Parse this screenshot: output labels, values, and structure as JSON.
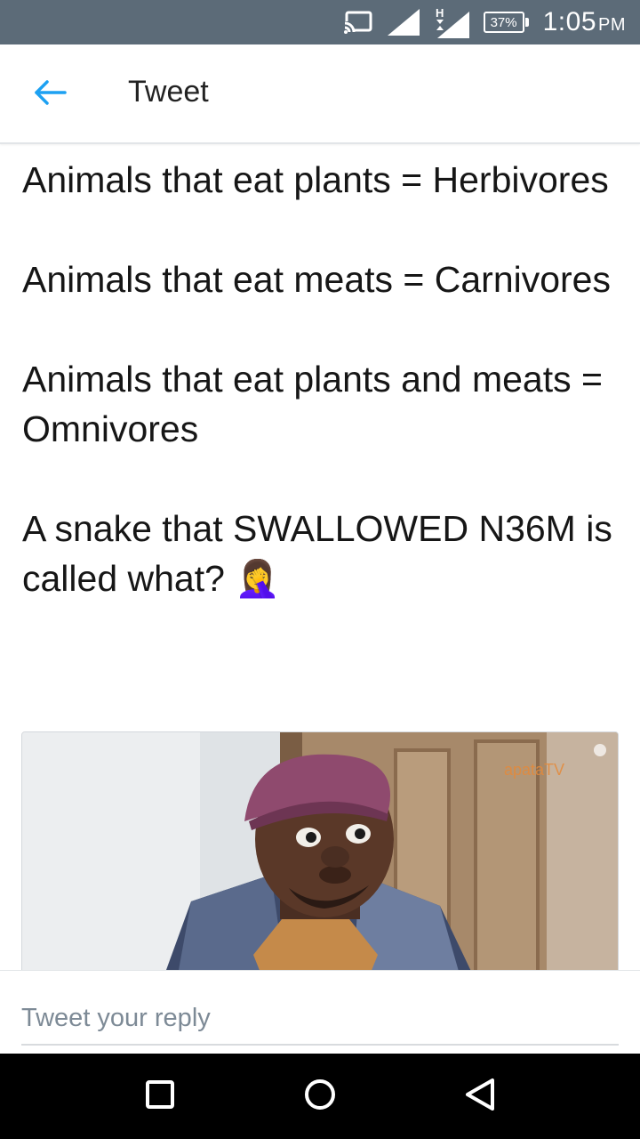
{
  "status_bar": {
    "battery": "37%",
    "time": "1:05",
    "ampm": "PM",
    "icons": [
      "cast-icon",
      "cell-signal-icon",
      "h-data-signal-icon",
      "battery-icon"
    ]
  },
  "app_bar": {
    "title": "Tweet",
    "back_icon": "back-arrow-icon",
    "accent_color": "#1da1f2"
  },
  "tweet": {
    "paragraphs": [
      "Animals that eat plants = Herbivores",
      "Animals that eat meats = Carnivores",
      "Animals that eat plants and meats = Omnivores",
      "A snake that SWALLOWED N36M is called what? 🤦‍♀"
    ],
    "media": {
      "type": "image",
      "watermark": "apataTV"
    }
  },
  "reply": {
    "placeholder": "Tweet your reply"
  },
  "nav_bar": {
    "buttons": [
      "recents-square-icon",
      "home-circle-icon",
      "back-triangle-icon"
    ]
  }
}
